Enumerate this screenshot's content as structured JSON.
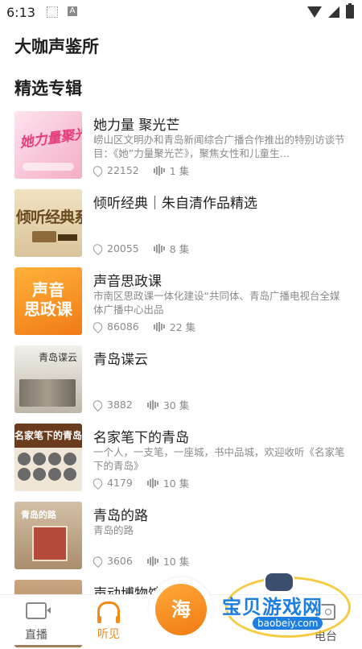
{
  "status_bar": {
    "time": "6:13",
    "app_icon_letter": "A"
  },
  "header": {
    "title": "大咖声鉴所"
  },
  "section": {
    "title": "精选专辑"
  },
  "albums": [
    {
      "title": "她力量 聚光芒",
      "description": "崂山区文明办和青岛新闻综合广播合作推出的特别访谈节目：《她”力量聚光芒》，聚焦女性和儿童生…",
      "plays": "22152",
      "episodes": "1 集",
      "cover_text": "她力量聚光芒"
    },
    {
      "title": "倾听经典｜朱自清作品精选",
      "description": "",
      "plays": "20055",
      "episodes": "8 集",
      "cover_text": "倾听经典系列"
    },
    {
      "title": "声音思政课",
      "description": "市南区思政课一体化建设“共同体、青岛广播电视台全媒体广播中心出品",
      "plays": "86086",
      "episodes": "22 集",
      "cover_line1": "声音",
      "cover_line2": "思政课"
    },
    {
      "title": "青岛谍云",
      "description": "",
      "plays": "3882",
      "episodes": "30 集",
      "cover_text": "青岛谍云"
    },
    {
      "title": "名家笔下的青岛",
      "description": "一个人，一支笔，一座城，书中品城，欢迎收听《名家笔下的青岛》",
      "plays": "4179",
      "episodes": "10 集",
      "cover_text": "名家笔下的青岛"
    },
    {
      "title": "青岛的路",
      "description": "青岛的路",
      "plays": "3606",
      "episodes": "10 集",
      "cover_text": "青岛的路"
    },
    {
      "title": "声动博物馆",
      "description": "",
      "plays": "",
      "episodes": ""
    }
  ],
  "bottom_nav": {
    "live": "直播",
    "listen": "听见",
    "center": "海",
    "station": "电台"
  },
  "watermark": {
    "text": "宝贝游戏网",
    "url": "baobeiy.com"
  },
  "colors": {
    "accent": "#f28a17",
    "text": "#222222",
    "muted": "#8a8a8a"
  }
}
